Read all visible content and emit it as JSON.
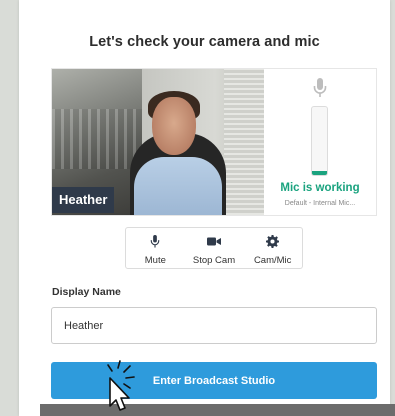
{
  "dialog": {
    "title": "Let's check your camera and mic"
  },
  "video": {
    "participant_name": "Heather"
  },
  "mic": {
    "status": "Mic is working",
    "device": "Default - Internal Mic...",
    "level": 0.06,
    "status_color": "#1aa37f"
  },
  "toolbar": {
    "mute_label": "Mute",
    "stop_cam_label": "Stop Cam",
    "cam_mic_label": "Cam/Mic"
  },
  "form": {
    "display_name_label": "Display Name",
    "display_name_value": "Heather"
  },
  "actions": {
    "enter_label": "Enter Broadcast Studio",
    "accent_color": "#2e9bdc"
  }
}
